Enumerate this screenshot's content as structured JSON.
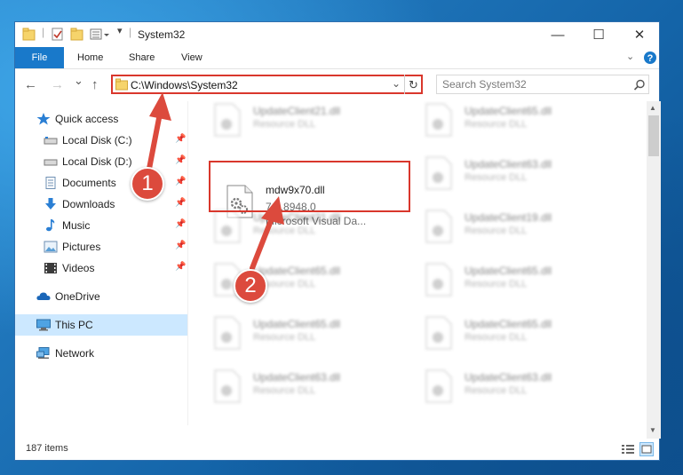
{
  "window": {
    "title": "System32",
    "controls": {
      "minimize": "—",
      "maximize": "☐",
      "close": "✕"
    }
  },
  "ribbon": {
    "tabs": [
      "File",
      "Home",
      "Share",
      "View"
    ]
  },
  "nav": {
    "back": "←",
    "forward": "→",
    "recent": "⌄",
    "up": "↑",
    "address": "C:\\Windows\\System32",
    "refresh": "↻",
    "search_placeholder": "Search System32"
  },
  "sidebar": {
    "items": [
      {
        "label": "Quick access",
        "icon": "star-icon"
      },
      {
        "label": "Local Disk (C:)",
        "icon": "drive-icon",
        "pinned": true
      },
      {
        "label": "Local Disk (D:)",
        "icon": "drive-icon",
        "pinned": true
      },
      {
        "label": "Documents",
        "icon": "documents-icon",
        "pinned": true
      },
      {
        "label": "Downloads",
        "icon": "download-icon",
        "pinned": true
      },
      {
        "label": "Music",
        "icon": "music-icon",
        "pinned": true
      },
      {
        "label": "Pictures",
        "icon": "pictures-icon",
        "pinned": true
      },
      {
        "label": "Videos",
        "icon": "videos-icon",
        "pinned": true
      },
      {
        "label": "OneDrive",
        "icon": "cloud-icon"
      },
      {
        "label": "This PC",
        "icon": "computer-icon",
        "selected": true
      },
      {
        "label": "Network",
        "icon": "network-icon"
      }
    ]
  },
  "files": {
    "highlighted": {
      "name": "mdw9x70.dll",
      "version": "7.0.8948.0",
      "description": "Microsoft Visual Da..."
    },
    "blurred": [
      {
        "name": "UpdateClient21.dll",
        "desc": "Resource DLL"
      },
      {
        "name": "UpdateClient65.dll",
        "desc": "Resource DLL"
      },
      {
        "name": "UpdateClient63.dll",
        "desc": "Resource DLL"
      },
      {
        "name": "UpdateClient21.dll",
        "desc": "Resource DLL"
      },
      {
        "name": "UpdateClient19.dll",
        "desc": "Resource DLL"
      },
      {
        "name": "UpdateClient65.dll",
        "desc": "Resource DLL"
      },
      {
        "name": "UpdateClient65.dll",
        "desc": "Resource DLL"
      },
      {
        "name": "UpdateClient65.dll",
        "desc": "Resource DLL"
      },
      {
        "name": "UpdateClient65.dll",
        "desc": "Resource DLL"
      },
      {
        "name": "UpdateClient63.dll",
        "desc": "Resource DLL"
      },
      {
        "name": "UpdateClient63.dll",
        "desc": "Resource DLL"
      }
    ]
  },
  "status": {
    "items_count": "187 items"
  },
  "annotations": {
    "marker_1": "1",
    "marker_2": "2"
  },
  "colors": {
    "accent": "#1979ca",
    "highlight_red": "#d9372c",
    "marker_red": "#dc4a3d",
    "selection": "#cce8ff"
  }
}
